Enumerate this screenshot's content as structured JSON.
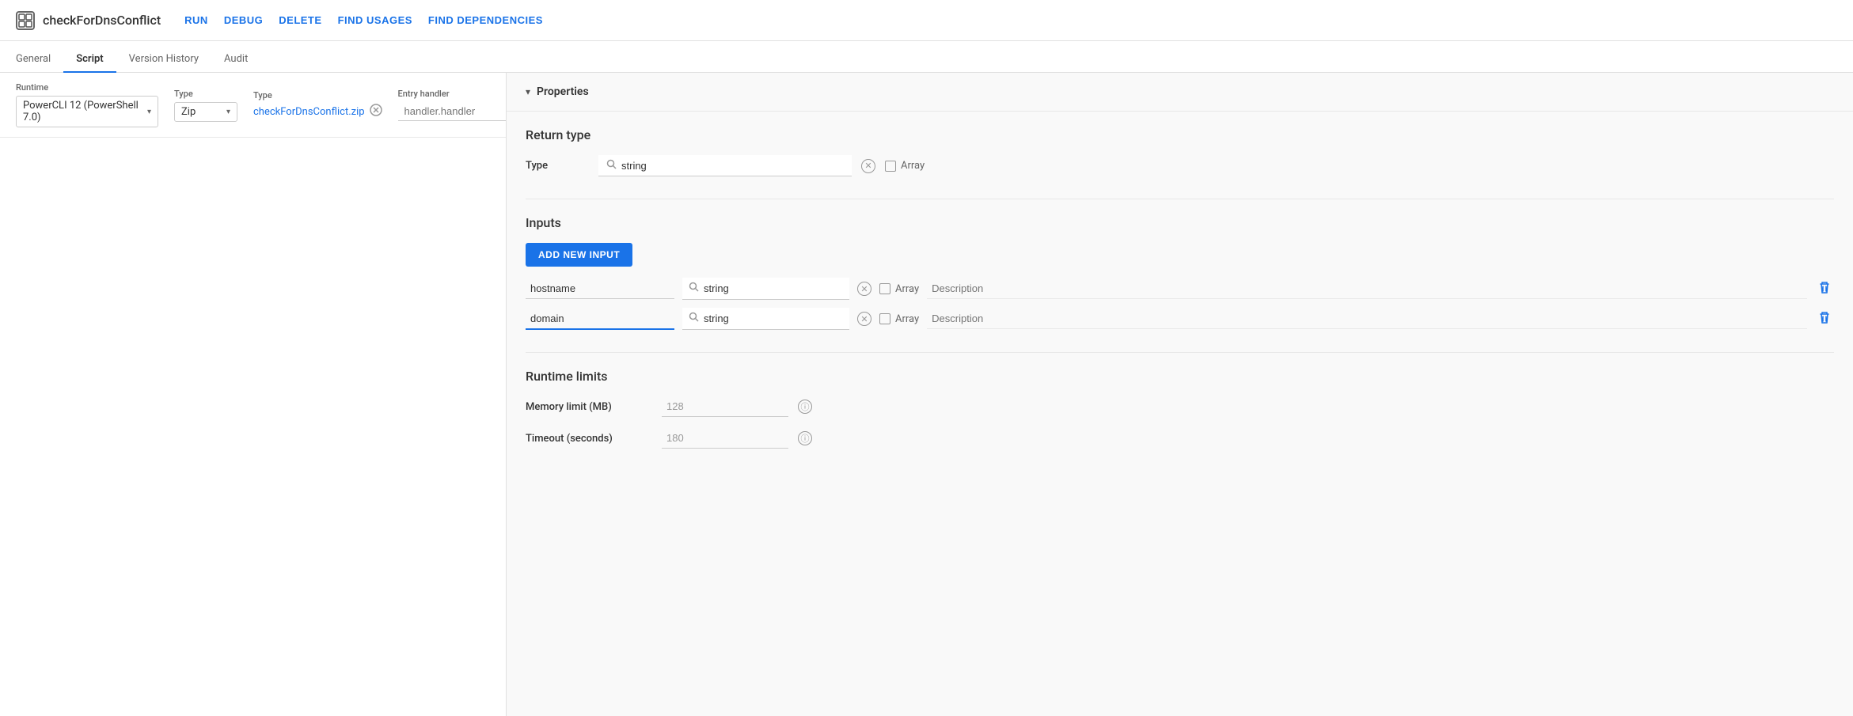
{
  "app": {
    "icon": "▣",
    "title": "checkForDnsConflict"
  },
  "topActions": [
    {
      "id": "run",
      "label": "RUN"
    },
    {
      "id": "debug",
      "label": "DEBUG"
    },
    {
      "id": "delete",
      "label": "DELETE"
    },
    {
      "id": "findUsages",
      "label": "FIND USAGES"
    },
    {
      "id": "findDependencies",
      "label": "FIND DEPENDENCIES"
    }
  ],
  "tabs": [
    {
      "id": "general",
      "label": "General",
      "active": false
    },
    {
      "id": "script",
      "label": "Script",
      "active": true
    },
    {
      "id": "versionHistory",
      "label": "Version History",
      "active": false
    },
    {
      "id": "audit",
      "label": "Audit",
      "active": false
    }
  ],
  "scriptConfig": {
    "runtimeLabel": "Runtime",
    "runtimeValue": "PowerCLI 12 (PowerShell 7.0)",
    "typeLabel": "Type",
    "typeValue": "Zip",
    "fileTypeLabel": "Type",
    "fileName": "checkForDnsConflict.zip",
    "entryHandlerLabel": "Entry handler",
    "entryHandlerPlaceholder": "handler.handler"
  },
  "properties": {
    "headerLabel": "Properties",
    "returnType": {
      "sectionTitle": "Return type",
      "typeLabel": "Type",
      "typeValue": "string",
      "arrayLabel": "Array"
    },
    "inputs": {
      "sectionTitle": "Inputs",
      "addButtonLabel": "ADD NEW INPUT",
      "rows": [
        {
          "name": "hostname",
          "nameActive": false,
          "typeValue": "string",
          "arrayLabel": "Array",
          "descriptionPlaceholder": "Description"
        },
        {
          "name": "domain",
          "nameActive": true,
          "typeValue": "string",
          "arrayLabel": "Array",
          "descriptionPlaceholder": "Description"
        }
      ]
    },
    "runtimeLimits": {
      "sectionTitle": "Runtime limits",
      "memoryLabel": "Memory limit (MB)",
      "memoryValue": "128",
      "timeoutLabel": "Timeout (seconds)",
      "timeoutValue": "180"
    }
  }
}
